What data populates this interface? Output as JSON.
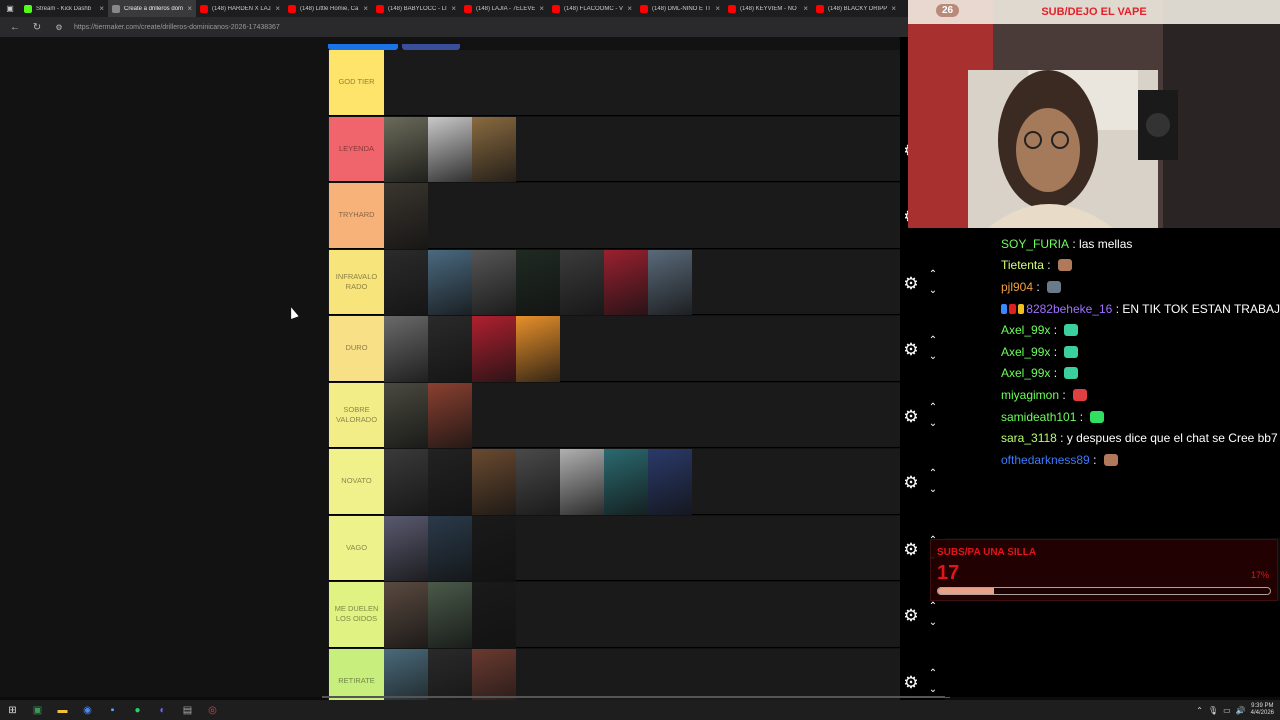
{
  "browser": {
    "tabs": [
      {
        "title": "Stream - Kick Dashb",
        "color": "#53fc18"
      },
      {
        "title": "Create a drilleros dom",
        "color": "#888888",
        "active": true
      },
      {
        "title": "(148) HARDEN X LAJA",
        "color": "#ff0000"
      },
      {
        "title": "(148) Little Homie, Ca",
        "color": "#ff0000"
      },
      {
        "title": "(148) BABYLOCC - LI",
        "color": "#ff0000"
      },
      {
        "title": "(148) LAJIA - 7ELEVEN",
        "color": "#ff0000"
      },
      {
        "title": "(148) FLACOOMC - V",
        "color": "#ff0000"
      },
      {
        "title": "(148) DML-NIÑO E TI",
        "color": "#ff0000"
      },
      {
        "title": "(148) KEYVIEM - NO",
        "color": "#ff0000"
      },
      {
        "title": "(148) BLACKY DRIPP",
        "color": "#ff0000"
      }
    ],
    "url": "https://tiermaker.com/create/drilleros-dominicanos-2026-17438367"
  },
  "tiers": [
    {
      "label": "GOD TIER",
      "color": "#ffe46b",
      "items": []
    },
    {
      "label": "LEYENDA",
      "color": "#f0656b",
      "items": [
        "#6b6b5a",
        "#c9c9c9",
        "#8a6a40"
      ]
    },
    {
      "label": "TRYHARD",
      "color": "#f7b27a",
      "items": [
        "#3a352e"
      ]
    },
    {
      "label": "INFRAVALO RADO",
      "color": "#f7e47a",
      "items": [
        "#2b2b2b",
        "#4a6a80",
        "#555555",
        "#1f2a22",
        "#3b3b3b",
        "#9a2030",
        "#5a6a7a"
      ]
    },
    {
      "label": "DURO",
      "color": "#f7e085",
      "items": [
        "#6a6a6a",
        "#2a2a2a",
        "#b02030",
        "#e8902a"
      ]
    },
    {
      "label": "SOBRE VALORADO",
      "color": "#f3ed87",
      "items": [
        "#4a4a40",
        "#8a4030"
      ]
    },
    {
      "label": "NOVATO",
      "color": "#f1f18c",
      "items": [
        "#3a3a3a",
        "#222222",
        "#6a4a30",
        "#4a4a4a",
        "#b0b0b0",
        "#2a6a70",
        "#2a3a6a"
      ]
    },
    {
      "label": "VAGO",
      "color": "#edf38a",
      "items": [
        "#5a5a70",
        "#2a3a4a",
        "#1a1a1a"
      ]
    },
    {
      "label": "ME DUELEN LOS OIDOS",
      "color": "#e0f281",
      "items": [
        "#5a4a40",
        "#4a5a4a",
        "#1a1a1a"
      ]
    },
    {
      "label": "RETIRATE",
      "color": "#c8ee7e",
      "items": [
        "#4a6a7a",
        "#2a2a2a",
        "#6a3a30"
      ]
    }
  ],
  "overlay": {
    "goal_count": "26",
    "goal_title": "SUB/DEJO EL VAPE",
    "chat": [
      {
        "user": "SOY_FURIA",
        "color": "#6bff5a",
        "msg": "las mellas",
        "emote": ""
      },
      {
        "user": "Tietenta",
        "color": "#d6ff7a",
        "msg": "",
        "emote": "#b07a5a"
      },
      {
        "user": "pjl904",
        "color": "#f0a040",
        "msg": "",
        "emote": "#6a7a8a"
      },
      {
        "user": "8282beheke_16",
        "color": "#a070ff",
        "msg": "EN TIK TOK ESTAN TRABAJ",
        "emote": "",
        "badges": [
          "#3a8aff",
          "#e02020",
          "#f0c020"
        ]
      },
      {
        "user": "Axel_99x",
        "color": "#6bff5a",
        "msg": "",
        "emote": "#3ad0a0"
      },
      {
        "user": "Axel_99x",
        "color": "#6bff5a",
        "msg": "",
        "emote": "#3ad0a0"
      },
      {
        "user": "Axel_99x",
        "color": "#6bff5a",
        "msg": "",
        "emote": "#3ad0a0"
      },
      {
        "user": "miyagimon",
        "color": "#6bff5a",
        "msg": "",
        "emote": "#e04040"
      },
      {
        "user": "samideath101",
        "color": "#6bff5a",
        "msg": "",
        "emote": "#30e060"
      },
      {
        "user": "sara_3118",
        "color": "#b6ff6b",
        "msg": "y despues dice que el chat se Cree bb7",
        "emote": ""
      },
      {
        "user": "ofthedarkness89",
        "color": "#3a7aff",
        "msg": "",
        "emote": "#b07a5a"
      }
    ],
    "subgoal": {
      "label": "SUBS/PA UNA SILLA",
      "count": "17",
      "percent": "17%",
      "progress": 0.17
    }
  },
  "taskbar": {
    "time": "9:39 PM",
    "date": "4/4/2026"
  }
}
